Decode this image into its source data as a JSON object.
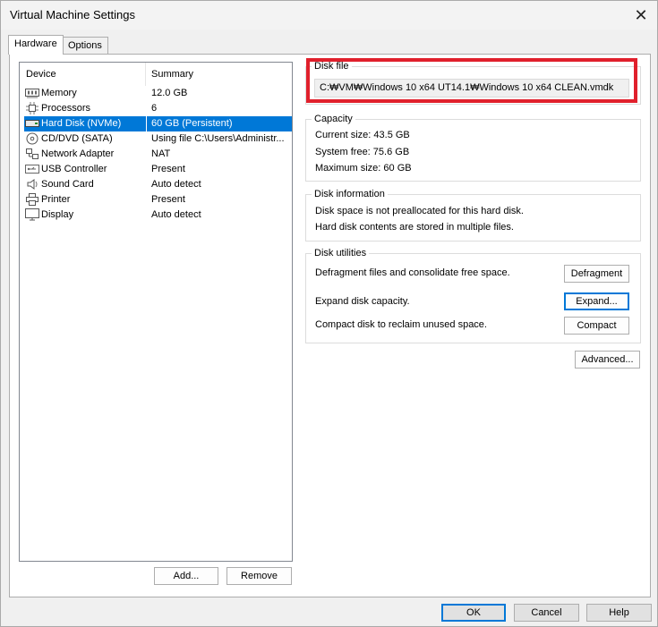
{
  "window": {
    "title": "Virtual Machine Settings",
    "close_glyph": "✕"
  },
  "tabs": [
    {
      "label": "Hardware"
    },
    {
      "label": "Options"
    }
  ],
  "device_list": {
    "headers": {
      "device": "Device",
      "summary": "Summary"
    },
    "rows": [
      {
        "device": "Memory",
        "summary": "12.0 GB",
        "icon": "memory-icon"
      },
      {
        "device": "Processors",
        "summary": "6",
        "icon": "processor-icon"
      },
      {
        "device": "Hard Disk (NVMe)",
        "summary": "60 GB (Persistent)",
        "icon": "hard-disk-icon",
        "selected": true
      },
      {
        "device": "CD/DVD (SATA)",
        "summary": "Using file C:\\Users\\Administr...",
        "icon": "cd-dvd-icon"
      },
      {
        "device": "Network Adapter",
        "summary": "NAT",
        "icon": "network-adapter-icon"
      },
      {
        "device": "USB Controller",
        "summary": "Present",
        "icon": "usb-icon"
      },
      {
        "device": "Sound Card",
        "summary": "Auto detect",
        "icon": "speaker-icon"
      },
      {
        "device": "Printer",
        "summary": "Present",
        "icon": "printer-icon"
      },
      {
        "device": "Display",
        "summary": "Auto detect",
        "icon": "display-icon"
      }
    ]
  },
  "left_buttons": {
    "add": "Add...",
    "remove": "Remove"
  },
  "disk_file": {
    "label": "Disk file",
    "path": "C:₩VM₩Windows 10 x64 UT14.1₩Windows 10 x64 CLEAN.vmdk"
  },
  "capacity": {
    "label": "Capacity",
    "current": "Current size:  43.5 GB",
    "system_free": "System free:  75.6 GB",
    "maximum": "Maximum size:  60 GB"
  },
  "disk_information": {
    "label": "Disk information",
    "line1": "Disk space is not preallocated for this hard disk.",
    "line2": "Hard disk contents are stored in multiple files."
  },
  "disk_utilities": {
    "label": "Disk utilities",
    "defrag_text": "Defragment files and consolidate free space.",
    "defrag_button": "Defragment",
    "expand_text": "Expand disk capacity.",
    "expand_button": "Expand...",
    "compact_text": "Compact disk to reclaim unused space.",
    "compact_button": "Compact"
  },
  "advanced_button": "Advanced...",
  "footer": {
    "ok": "OK",
    "cancel": "Cancel",
    "help": "Help"
  },
  "colors": {
    "selection": "#0078d7",
    "highlight_box": "#e0202c"
  }
}
